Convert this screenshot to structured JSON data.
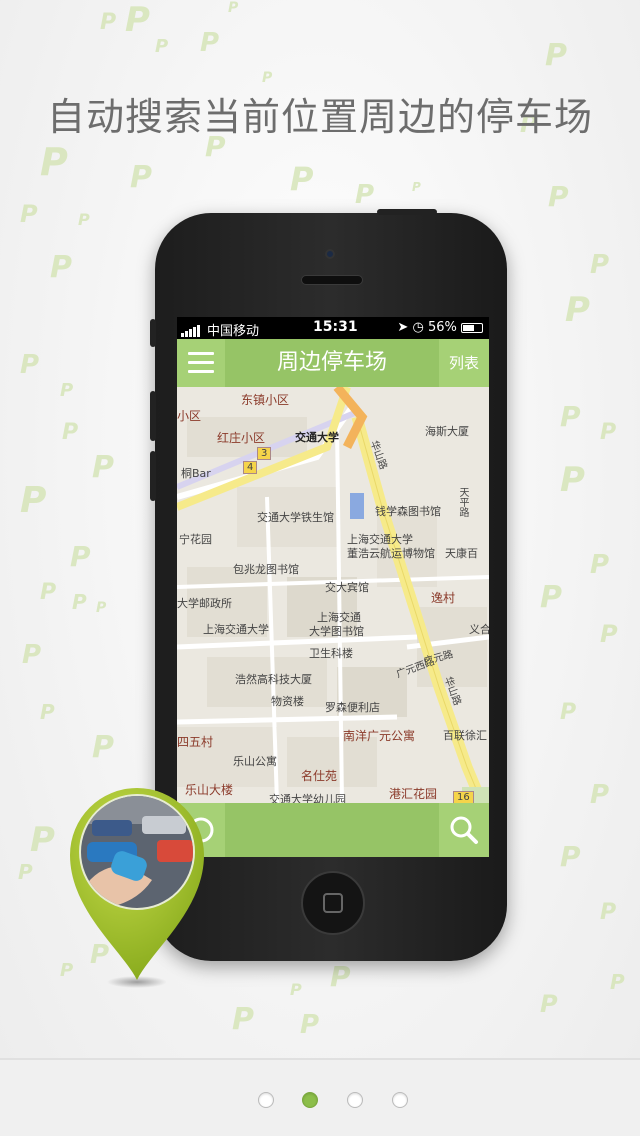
{
  "headline": "自动搜索当前位置周边的停车场",
  "status_bar": {
    "carrier": "中国移动",
    "time": "15:31",
    "battery": "56%"
  },
  "nav": {
    "title": "周边停车场",
    "list_label": "列表"
  },
  "map": {
    "labels": [
      "东镇小区",
      "小区",
      "红庄小区",
      "交通大学",
      "海斯大厦",
      "华山路",
      "桐Bar",
      "天平路",
      "钱学森图书馆",
      "交通大学铁生馆",
      "宁花园",
      "上海交通大学",
      "董浩云航运博物馆",
      "天康百",
      "包兆龙图书馆",
      "交大宾馆",
      "逸村",
      "大学邮政所",
      "上海交通大学",
      "上海交通",
      "大学图书馆",
      "义合",
      "卫生科楼",
      "广元西路",
      "广元路",
      "浩然高科技大厦",
      "物资楼",
      "罗森便利店",
      "华山路",
      "南洋广元公寓",
      "百联徐汇",
      "四五村",
      "乐山公寓",
      "名仕苑",
      "乐山大楼",
      "港汇花园",
      "交通大学幼儿园"
    ],
    "route_badges": [
      "3",
      "4",
      "16"
    ]
  },
  "colors": {
    "accent": "#96c466",
    "accent_light": "#a6d176",
    "pin": "#9bbf2a",
    "headline": "#6d6d6d"
  },
  "pager": {
    "current_page": 2
  }
}
